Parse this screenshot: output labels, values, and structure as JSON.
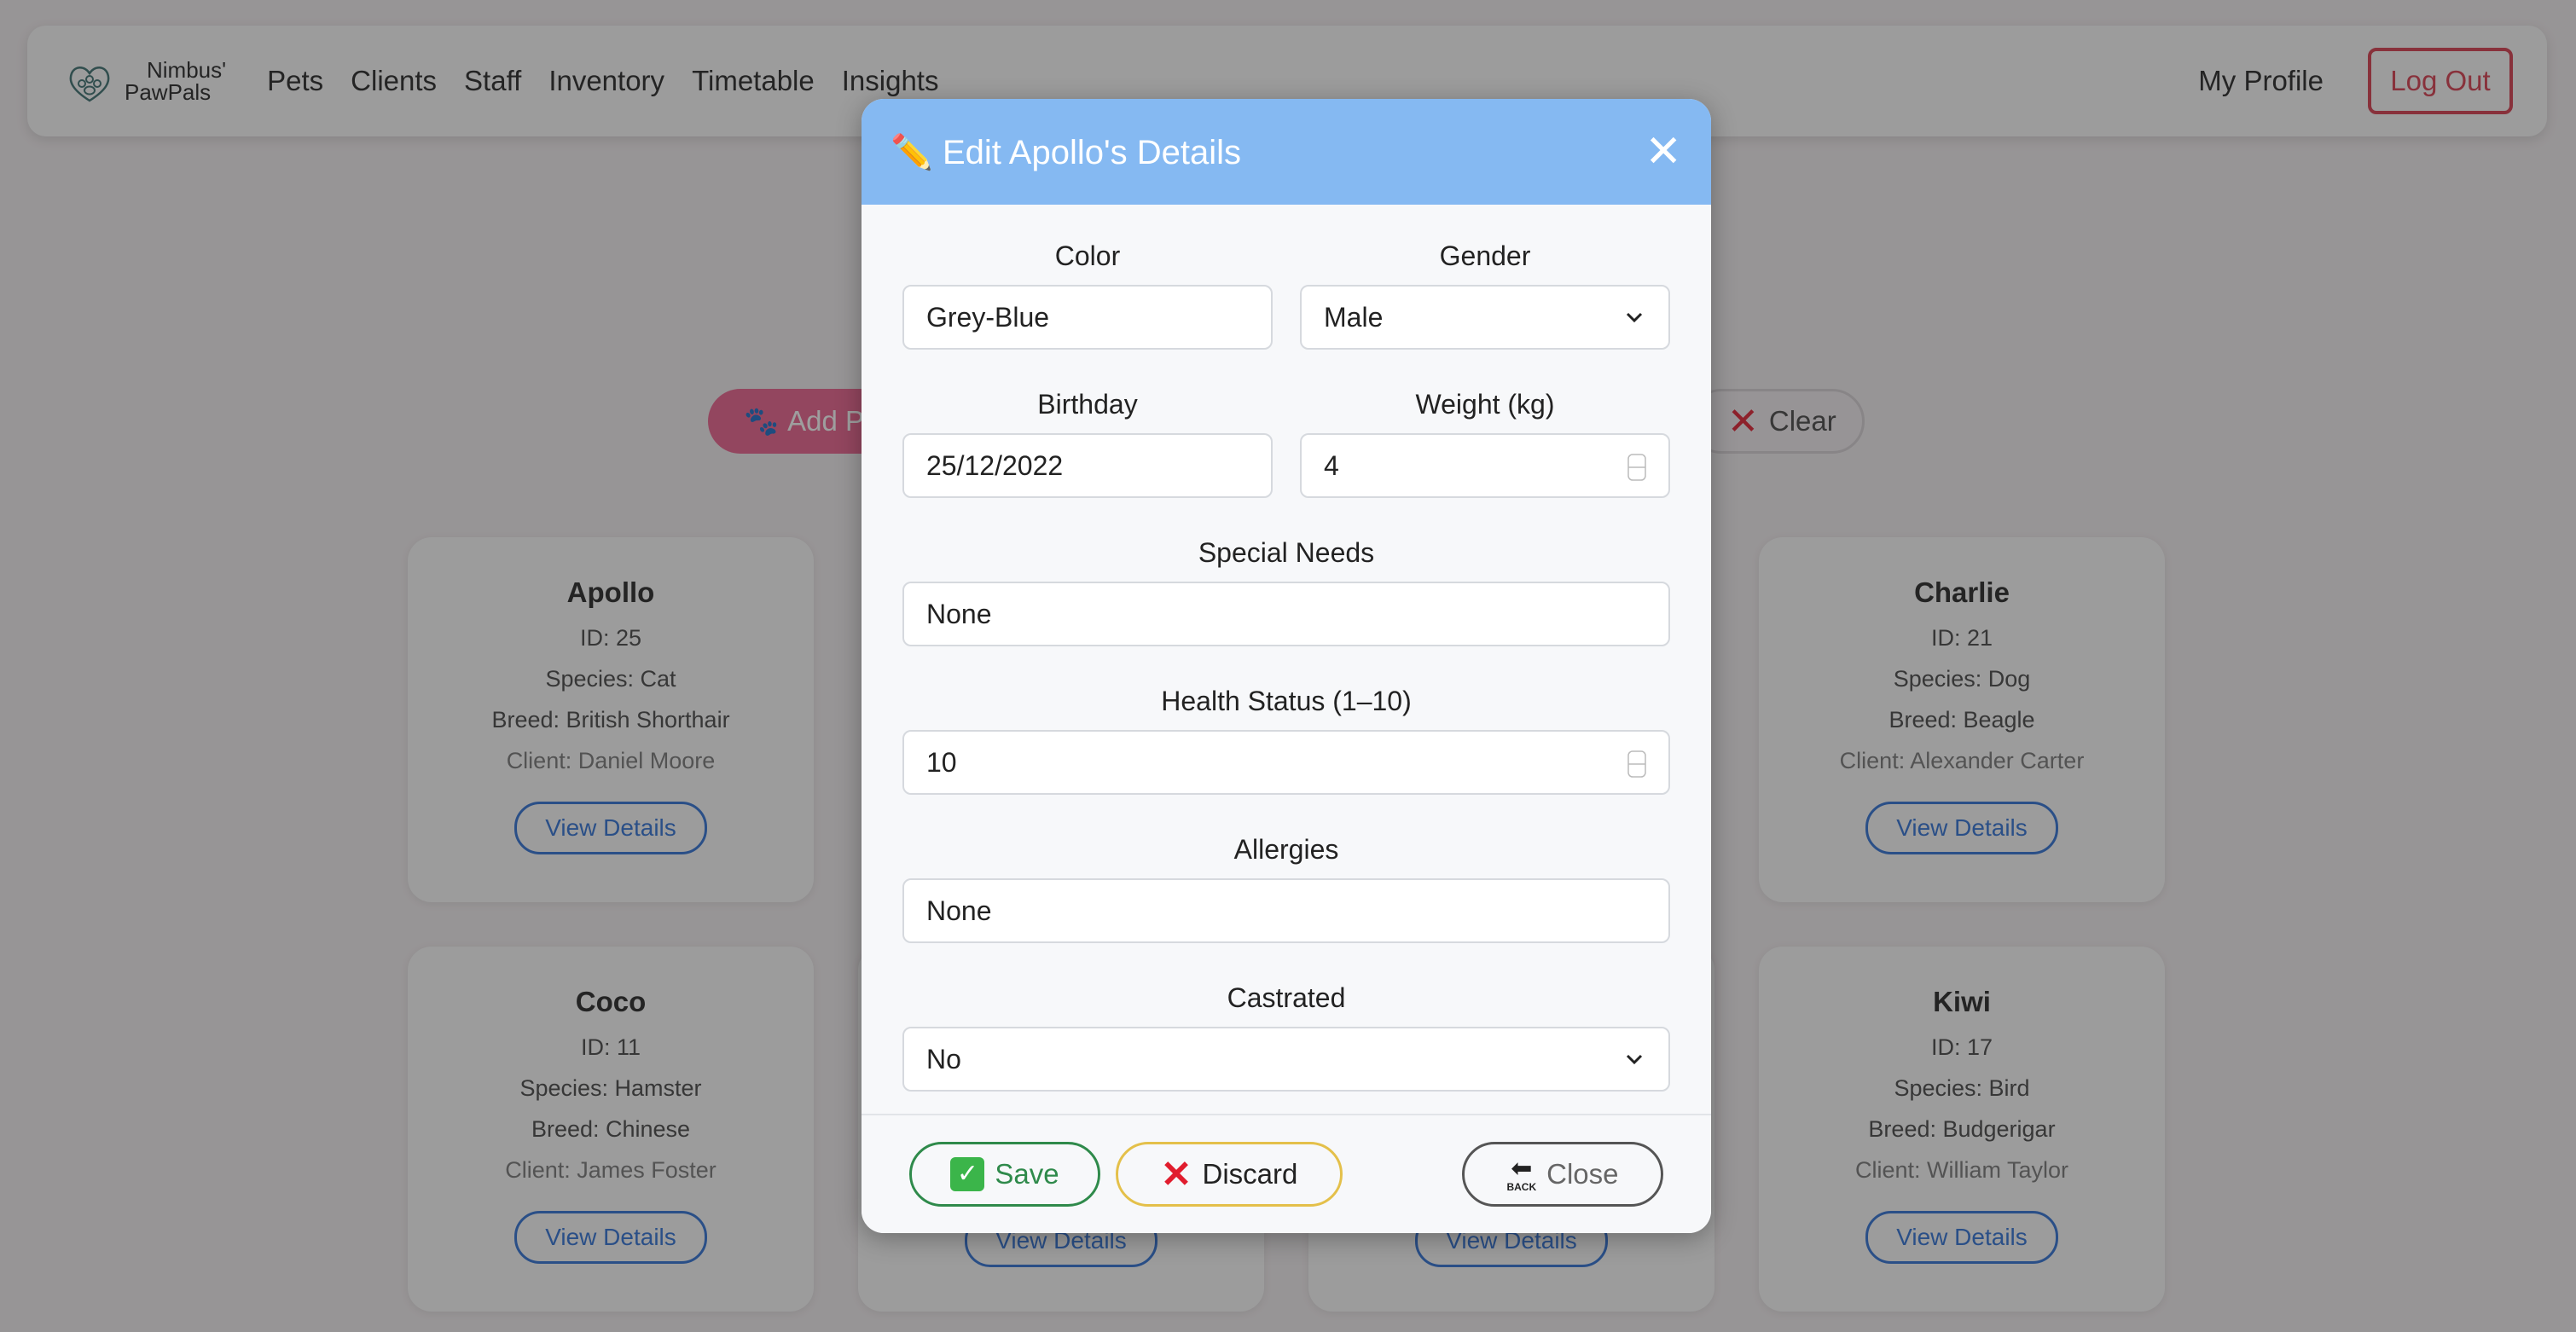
{
  "nav": {
    "brand_line1": "Nimbus'",
    "brand_line2": "PawPals",
    "links": [
      "Pets",
      "Clients",
      "Staff",
      "Inventory",
      "Timetable",
      "Insights"
    ],
    "profile": "My Profile",
    "logout": "Log Out"
  },
  "toolbar": {
    "add_label": "Add P",
    "clear_label": "Clear"
  },
  "cards": [
    {
      "name": "Apollo",
      "id": "ID: 25",
      "species": "Species: Cat",
      "breed": "Breed: British Shorthair",
      "client": "Client: Daniel Moore",
      "button": "View Details"
    },
    {
      "name": "Charlie",
      "id": "ID: 21",
      "species": "Species: Dog",
      "breed": "Breed: Beagle",
      "client": "Client: Alexander Carter",
      "button": "View Details"
    },
    {
      "name": "Coco",
      "id": "ID: 11",
      "species": "Species: Hamster",
      "breed": "Breed: Chinese",
      "client": "Client: James Foster",
      "button": "View Details"
    },
    {
      "name": "Kiwi",
      "id": "ID: 17",
      "species": "Species: Bird",
      "breed": "Breed: Budgerigar",
      "client": "Client: William Taylor",
      "button": "View Details"
    },
    {
      "button": "View Details"
    },
    {
      "button": "View Details"
    }
  ],
  "modal": {
    "title_icon": "✏️",
    "title": "Edit Apollo's Details",
    "close_symbol": "✕",
    "fields": {
      "color": {
        "label": "Color",
        "value": "Grey-Blue"
      },
      "gender": {
        "label": "Gender",
        "value": "Male"
      },
      "birthday": {
        "label": "Birthday",
        "value": "25/12/2022"
      },
      "weight": {
        "label": "Weight (kg)",
        "value": "4"
      },
      "special_needs": {
        "label": "Special Needs",
        "value": "None"
      },
      "health_status": {
        "label": "Health Status (1–10)",
        "value": "10"
      },
      "allergies": {
        "label": "Allergies",
        "value": "None"
      },
      "castrated": {
        "label": "Castrated",
        "value": "No"
      }
    },
    "footer": {
      "save": "Save",
      "discard": "Discard",
      "close": "Close",
      "back_icon_text": "BACK"
    }
  },
  "icons": {
    "paw": "paw-icon",
    "pencil": "pencil-icon",
    "cross": "cross-mark-icon",
    "check": "check-mark-icon"
  },
  "colors": {
    "modal_header": "#85b9f2",
    "logout": "#d83a4c",
    "add_button": "#ec5f8c",
    "view_details": "#2d6fd6",
    "save": "#2f8a4b",
    "discard_border": "#e4c04a"
  }
}
